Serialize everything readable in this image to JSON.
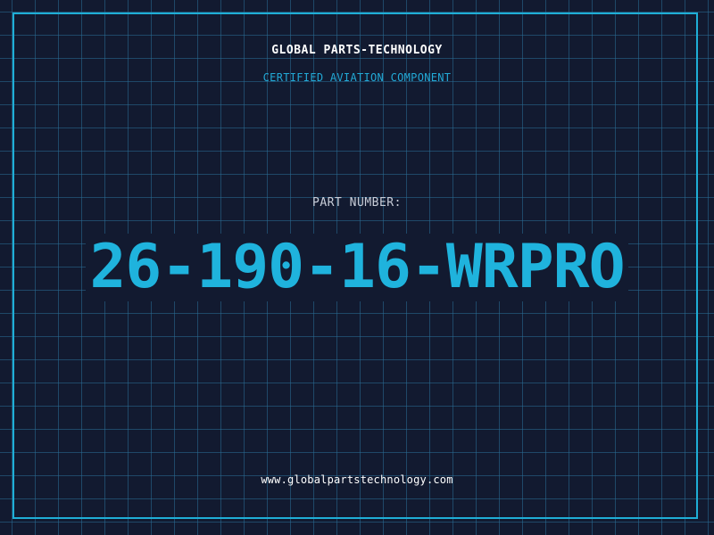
{
  "header": {
    "company_name": "GLOBAL PARTS-TECHNOLOGY",
    "subtitle": "CERTIFIED AVIATION COMPONENT"
  },
  "part": {
    "label": "PART NUMBER:",
    "number": "26-190-16-WRPRO"
  },
  "footer": {
    "url": "www.globalpartstechnology.com"
  },
  "colors": {
    "background": "#121a30",
    "grid": "#2a6e96",
    "accent": "#1fb3dd",
    "text": "#ffffff"
  }
}
